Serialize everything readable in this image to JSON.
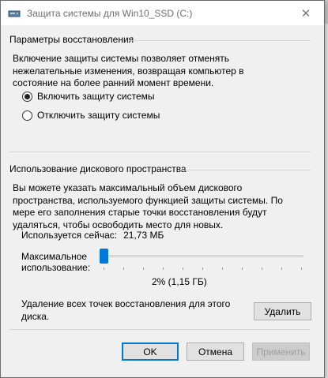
{
  "window": {
    "title": "Защита системы для Win10_SSD (C:)",
    "close_glyph": "✕"
  },
  "restore_settings": {
    "header": "Параметры восстановления",
    "description": "Включение защиты системы позволяет отменять нежелательные изменения, возвращая компьютер в состояние на более ранний момент времени.",
    "options": [
      {
        "label": "Включить защиту системы",
        "selected": true
      },
      {
        "label": "Отключить защиту системы",
        "selected": false
      }
    ]
  },
  "disk_usage": {
    "header": "Использование дискового пространства",
    "description": "Вы можете указать максимальный объем дискового пространства, используемого функцией защиты системы. По мере его заполнения старые точки восстановления будут удаляться, чтобы освободить место для новых.",
    "current_label": "Используется сейчас:",
    "current_value": "21,73 МБ",
    "max_label_line1": "Максимальное",
    "max_label_line2": "использование:",
    "slider_value_percent": 2,
    "slider_readout": "2% (1,15 ГБ)",
    "delete_text_line1": "Удаление всех точек восстановления для этого",
    "delete_text_line2": "диска.",
    "delete_button": "Удалить"
  },
  "footer": {
    "ok": "OK",
    "cancel": "Отмена",
    "apply": "Применить"
  },
  "colors": {
    "accent": "#0078d7"
  },
  "icons": {
    "title": "drive-shield-icon",
    "close": "close-icon"
  }
}
